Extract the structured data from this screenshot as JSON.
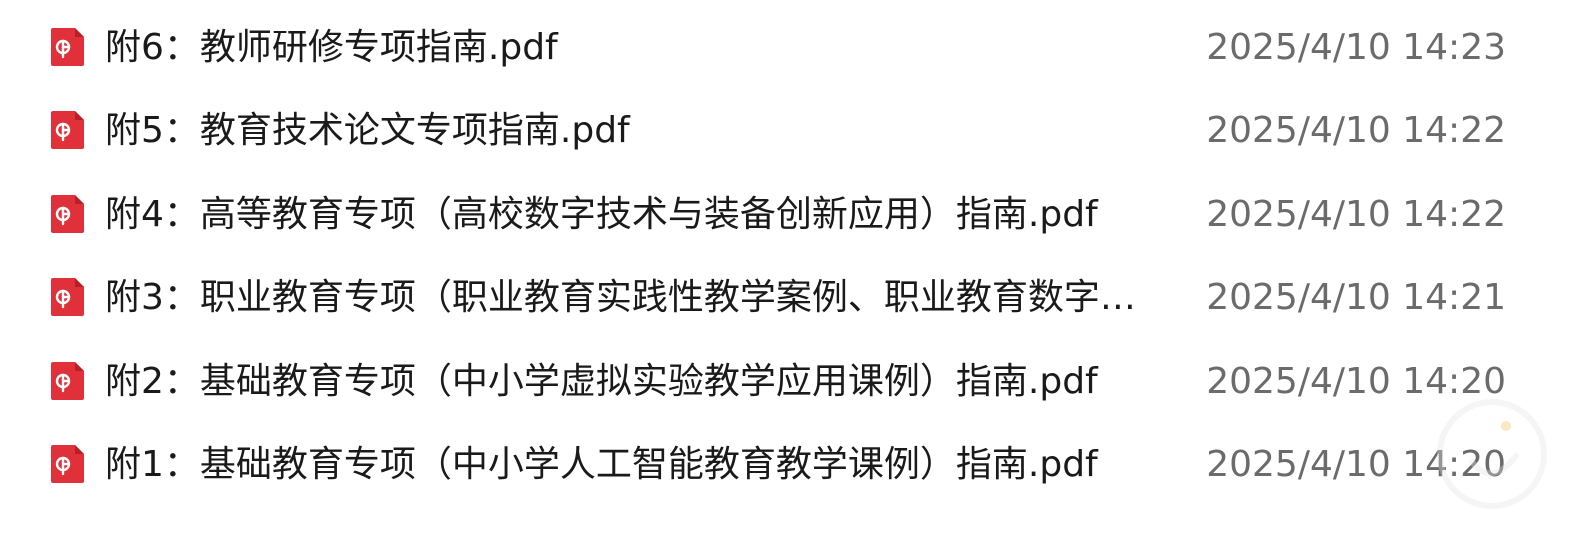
{
  "files": [
    {
      "name": "附6：教师研修专项指南.pdf",
      "modified": "2025/4/10 14:23",
      "icon": "pdf-icon"
    },
    {
      "name": "附5：教育技术论文专项指南.pdf",
      "modified": "2025/4/10 14:22",
      "icon": "pdf-icon"
    },
    {
      "name": "附4：高等教育专项（高校数字技术与装备创新应用）指南.pdf",
      "modified": "2025/4/10 14:22",
      "icon": "pdf-icon"
    },
    {
      "name": "附3：职业教育专项（职业教育实践性教学案例、职业教育数字教...",
      "modified": "2025/4/10 14:21",
      "icon": "pdf-icon"
    },
    {
      "name": "附2：基础教育专项（中小学虚拟实验教学应用课例）指南.pdf",
      "modified": "2025/4/10 14:20",
      "icon": "pdf-icon"
    },
    {
      "name": "附1：基础教育专项（中小学人工智能教育教学课例）指南.pdf",
      "modified": "2025/4/10 14:20",
      "icon": "pdf-icon"
    }
  ],
  "colors": {
    "pdf_red": "#e0303a",
    "pdf_dark_red": "#b81f28",
    "name_text": "#1a1a1a",
    "date_text": "#6b6b6b"
  }
}
